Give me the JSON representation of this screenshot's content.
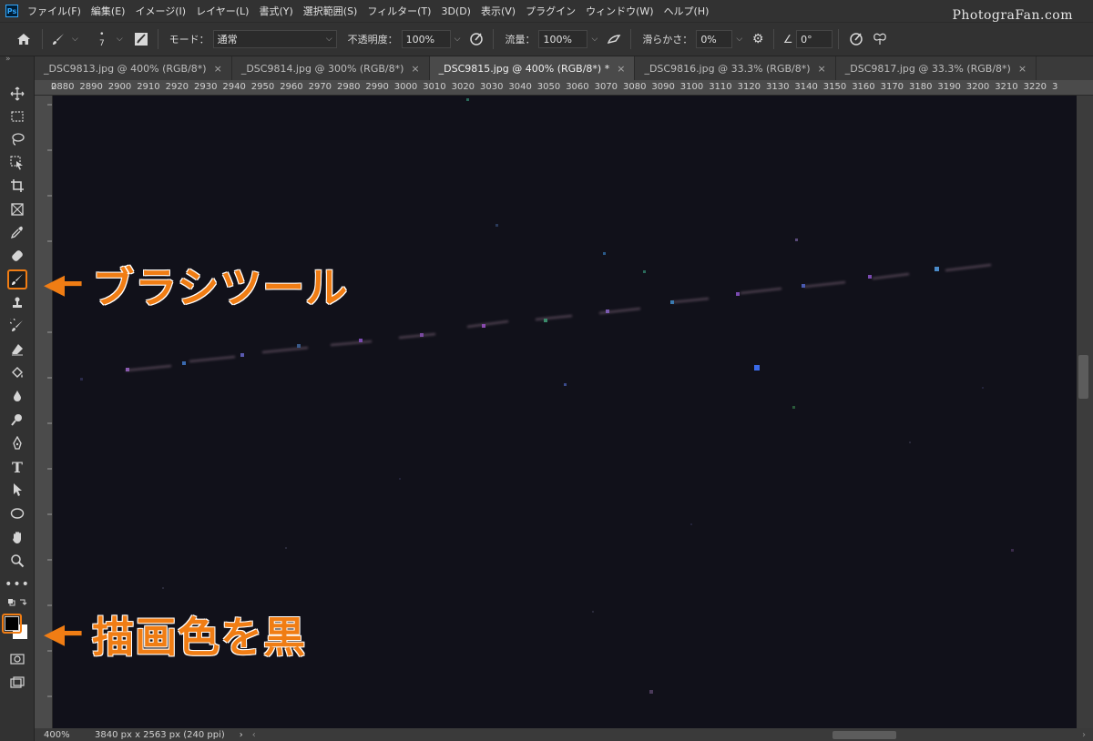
{
  "app": {
    "logo": "Ps"
  },
  "menu": [
    "ファイル(F)",
    "編集(E)",
    "イメージ(I)",
    "レイヤー(L)",
    "書式(Y)",
    "選択範囲(S)",
    "フィルター(T)",
    "3D(D)",
    "表示(V)",
    "プラグイン",
    "ウィンドウ(W)",
    "ヘルプ(H)"
  ],
  "options": {
    "brush_size": "7",
    "mode_label": "モード：",
    "mode_value": "通常",
    "opacity_label": "不透明度：",
    "opacity_value": "100%",
    "flow_label": "流量：",
    "flow_value": "100%",
    "smoothing_label": "滑らかさ：",
    "smoothing_value": "0%",
    "angle_value": "0°"
  },
  "watermark": "PhotograFan.com",
  "tabs": [
    {
      "label": "_DSC9813.jpg @ 400% (RGB/8*)",
      "active": false
    },
    {
      "label": "_DSC9814.jpg @ 300% (RGB/8*)",
      "active": false
    },
    {
      "label": "_DSC9815.jpg @ 400% (RGB/8*) *",
      "active": true
    },
    {
      "label": "_DSC9816.jpg @ 33.3% (RGB/8*)",
      "active": false
    },
    {
      "label": "_DSC9817.jpg @ 33.3% (RGB/8*)",
      "active": false
    }
  ],
  "tab_close": "×",
  "ruler_labels": [
    "0",
    "2880",
    "2890",
    "2900",
    "2910",
    "2920",
    "2930",
    "2940",
    "2950",
    "2960",
    "2970",
    "2980",
    "2990",
    "3000",
    "3010",
    "3020",
    "3030",
    "3040",
    "3050",
    "3060",
    "3070",
    "3080",
    "3090",
    "3100",
    "3110",
    "3120",
    "3130",
    "3140",
    "3150",
    "3160",
    "3170",
    "3180",
    "3190",
    "3200",
    "3210",
    "3220",
    "3"
  ],
  "status": {
    "zoom": "400%",
    "doc_size": "3840 px x 2563 px (240 ppi)",
    "arrow": "›"
  },
  "annotations": {
    "brush": "ブラシツール",
    "color": "描画色を黒"
  },
  "colors": {
    "accent": "#f07d14",
    "canvas": "#11111a"
  }
}
